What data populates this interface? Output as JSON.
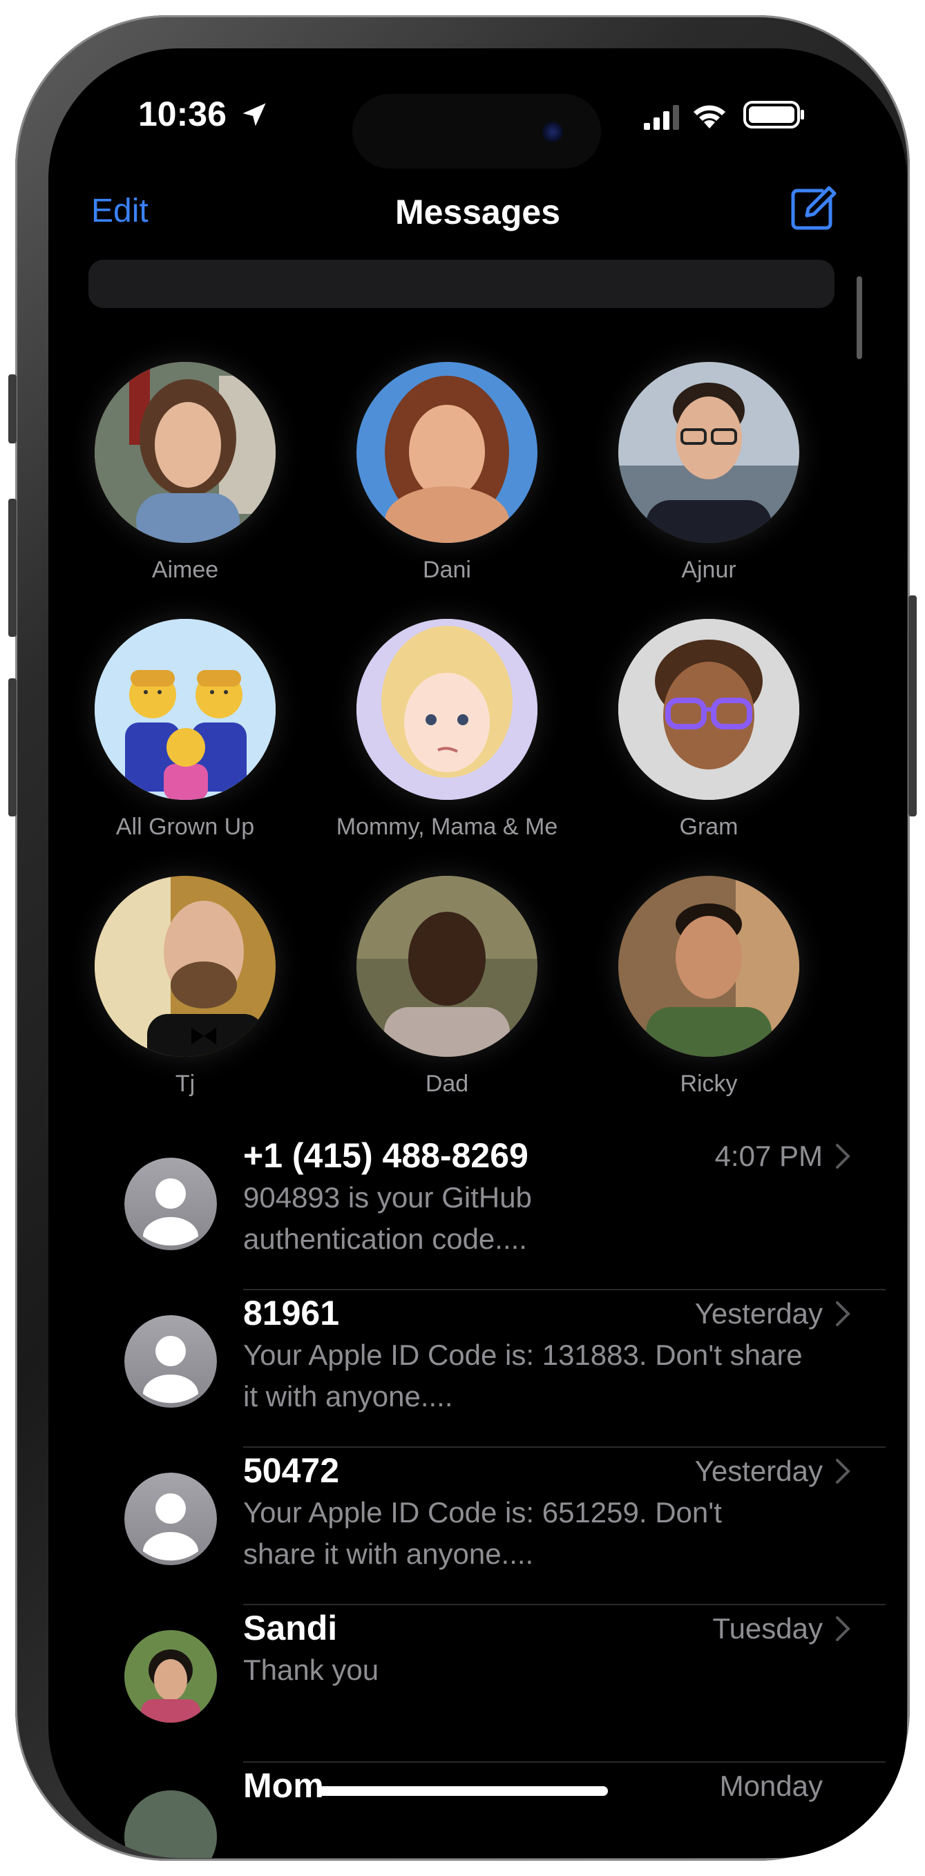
{
  "status_bar": {
    "time": "10:36"
  },
  "nav": {
    "edit_label": "Edit",
    "title": "Messages"
  },
  "accent_color": "#3b82f6",
  "pinned": [
    {
      "name": "Aimee",
      "type": "photo"
    },
    {
      "name": "Dani",
      "type": "photo"
    },
    {
      "name": "Ajnur",
      "type": "photo"
    },
    {
      "name": "All Grown Up",
      "type": "group-emoji"
    },
    {
      "name": "Mommy, Mama & Me",
      "type": "memoji"
    },
    {
      "name": "Gram",
      "type": "memoji"
    },
    {
      "name": "Tj",
      "type": "photo"
    },
    {
      "name": "Dad",
      "type": "photo"
    },
    {
      "name": "Ricky",
      "type": "photo"
    }
  ],
  "conversations": [
    {
      "name": "+1 (415) 488-8269",
      "time": "4:07 PM",
      "preview_line1": "904893 is your GitHub",
      "preview_line2": "authentication code....",
      "avatar": "person-placeholder-icon"
    },
    {
      "name": "81961",
      "time": "Yesterday",
      "preview_line1": "Your Apple ID Code is: 131883. Don't share",
      "preview_line2": "it with anyone....",
      "avatar": "person-placeholder-icon"
    },
    {
      "name": "50472",
      "time": "Yesterday",
      "preview_line1": "Your Apple ID Code is: 651259. Don't",
      "preview_line2": "share it with anyone....",
      "avatar": "person-placeholder-icon"
    },
    {
      "name": "Sandi",
      "time": "Tuesday",
      "preview_line1": "Thank you",
      "preview_line2": "",
      "avatar": "photo"
    },
    {
      "name": "Mom",
      "time": "Monday",
      "preview_line1": "",
      "preview_line2": "",
      "avatar": "photo"
    }
  ]
}
